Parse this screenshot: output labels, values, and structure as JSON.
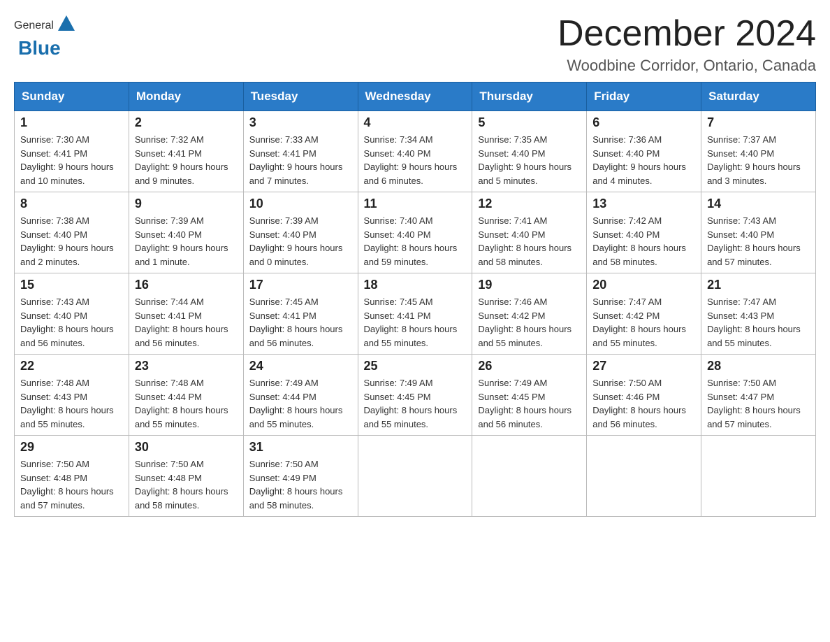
{
  "logo": {
    "general": "General",
    "blue": "Blue"
  },
  "title": {
    "month": "December 2024",
    "location": "Woodbine Corridor, Ontario, Canada"
  },
  "weekdays": [
    "Sunday",
    "Monday",
    "Tuesday",
    "Wednesday",
    "Thursday",
    "Friday",
    "Saturday"
  ],
  "weeks": [
    [
      {
        "day": "1",
        "sunrise": "7:30 AM",
        "sunset": "4:41 PM",
        "daylight": "9 hours and 10 minutes."
      },
      {
        "day": "2",
        "sunrise": "7:32 AM",
        "sunset": "4:41 PM",
        "daylight": "9 hours and 9 minutes."
      },
      {
        "day": "3",
        "sunrise": "7:33 AM",
        "sunset": "4:41 PM",
        "daylight": "9 hours and 7 minutes."
      },
      {
        "day": "4",
        "sunrise": "7:34 AM",
        "sunset": "4:40 PM",
        "daylight": "9 hours and 6 minutes."
      },
      {
        "day": "5",
        "sunrise": "7:35 AM",
        "sunset": "4:40 PM",
        "daylight": "9 hours and 5 minutes."
      },
      {
        "day": "6",
        "sunrise": "7:36 AM",
        "sunset": "4:40 PM",
        "daylight": "9 hours and 4 minutes."
      },
      {
        "day": "7",
        "sunrise": "7:37 AM",
        "sunset": "4:40 PM",
        "daylight": "9 hours and 3 minutes."
      }
    ],
    [
      {
        "day": "8",
        "sunrise": "7:38 AM",
        "sunset": "4:40 PM",
        "daylight": "9 hours and 2 minutes."
      },
      {
        "day": "9",
        "sunrise": "7:39 AM",
        "sunset": "4:40 PM",
        "daylight": "9 hours and 1 minute."
      },
      {
        "day": "10",
        "sunrise": "7:39 AM",
        "sunset": "4:40 PM",
        "daylight": "9 hours and 0 minutes."
      },
      {
        "day": "11",
        "sunrise": "7:40 AM",
        "sunset": "4:40 PM",
        "daylight": "8 hours and 59 minutes."
      },
      {
        "day": "12",
        "sunrise": "7:41 AM",
        "sunset": "4:40 PM",
        "daylight": "8 hours and 58 minutes."
      },
      {
        "day": "13",
        "sunrise": "7:42 AM",
        "sunset": "4:40 PM",
        "daylight": "8 hours and 58 minutes."
      },
      {
        "day": "14",
        "sunrise": "7:43 AM",
        "sunset": "4:40 PM",
        "daylight": "8 hours and 57 minutes."
      }
    ],
    [
      {
        "day": "15",
        "sunrise": "7:43 AM",
        "sunset": "4:40 PM",
        "daylight": "8 hours and 56 minutes."
      },
      {
        "day": "16",
        "sunrise": "7:44 AM",
        "sunset": "4:41 PM",
        "daylight": "8 hours and 56 minutes."
      },
      {
        "day": "17",
        "sunrise": "7:45 AM",
        "sunset": "4:41 PM",
        "daylight": "8 hours and 56 minutes."
      },
      {
        "day": "18",
        "sunrise": "7:45 AM",
        "sunset": "4:41 PM",
        "daylight": "8 hours and 55 minutes."
      },
      {
        "day": "19",
        "sunrise": "7:46 AM",
        "sunset": "4:42 PM",
        "daylight": "8 hours and 55 minutes."
      },
      {
        "day": "20",
        "sunrise": "7:47 AM",
        "sunset": "4:42 PM",
        "daylight": "8 hours and 55 minutes."
      },
      {
        "day": "21",
        "sunrise": "7:47 AM",
        "sunset": "4:43 PM",
        "daylight": "8 hours and 55 minutes."
      }
    ],
    [
      {
        "day": "22",
        "sunrise": "7:48 AM",
        "sunset": "4:43 PM",
        "daylight": "8 hours and 55 minutes."
      },
      {
        "day": "23",
        "sunrise": "7:48 AM",
        "sunset": "4:44 PM",
        "daylight": "8 hours and 55 minutes."
      },
      {
        "day": "24",
        "sunrise": "7:49 AM",
        "sunset": "4:44 PM",
        "daylight": "8 hours and 55 minutes."
      },
      {
        "day": "25",
        "sunrise": "7:49 AM",
        "sunset": "4:45 PM",
        "daylight": "8 hours and 55 minutes."
      },
      {
        "day": "26",
        "sunrise": "7:49 AM",
        "sunset": "4:45 PM",
        "daylight": "8 hours and 56 minutes."
      },
      {
        "day": "27",
        "sunrise": "7:50 AM",
        "sunset": "4:46 PM",
        "daylight": "8 hours and 56 minutes."
      },
      {
        "day": "28",
        "sunrise": "7:50 AM",
        "sunset": "4:47 PM",
        "daylight": "8 hours and 57 minutes."
      }
    ],
    [
      {
        "day": "29",
        "sunrise": "7:50 AM",
        "sunset": "4:48 PM",
        "daylight": "8 hours and 57 minutes."
      },
      {
        "day": "30",
        "sunrise": "7:50 AM",
        "sunset": "4:48 PM",
        "daylight": "8 hours and 58 minutes."
      },
      {
        "day": "31",
        "sunrise": "7:50 AM",
        "sunset": "4:49 PM",
        "daylight": "8 hours and 58 minutes."
      },
      null,
      null,
      null,
      null
    ]
  ],
  "labels": {
    "sunrise": "Sunrise:",
    "sunset": "Sunset:",
    "daylight": "Daylight:"
  }
}
